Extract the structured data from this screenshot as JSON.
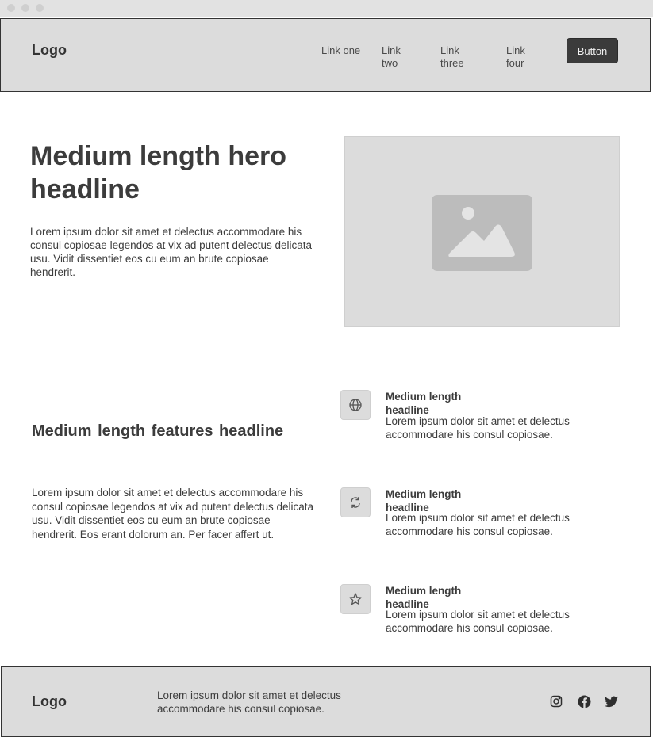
{
  "navbar": {
    "logo": "Logo",
    "links": [
      "Link one",
      "Link two",
      "Link three",
      "Link four"
    ],
    "button": "Button"
  },
  "hero": {
    "headline": "Medium length hero headline",
    "body": "Lorem ipsum dolor sit amet et delectus accommodare his consul copiosae legendos at vix ad putent delectus delicata usu. Vidit dissentiet eos cu eum an brute copiosae hendrerit.",
    "image_icon": "image-placeholder-icon"
  },
  "features": {
    "headline": "Medium length features headline",
    "body": "Lorem ipsum dolor sit amet et delectus accommodare his consul copiosae legendos at vix ad putent delectus delicata usu. Vidit dissentiet eos cu eum an brute copiosae hendrerit. Eos erant dolorum an. Per facer affert ut.",
    "items": [
      {
        "icon": "globe-icon",
        "title": "Medium length headline",
        "body": "Lorem ipsum dolor sit amet et delectus accommodare his consul copiosae."
      },
      {
        "icon": "refresh-icon",
        "title": "Medium length headline",
        "body": "Lorem ipsum dolor sit amet et delectus accommodare his consul copiosae."
      },
      {
        "icon": "star-icon",
        "title": "Medium length headline",
        "body": "Lorem ipsum dolor sit amet et delectus accommodare his consul copiosae."
      }
    ]
  },
  "footer": {
    "logo": "Logo",
    "text": "Lorem ipsum dolor sit amet et delectus accommodare his consul copiosae.",
    "social_icons": [
      "instagram-icon",
      "facebook-icon",
      "twitter-icon"
    ]
  },
  "colors": {
    "panel": "#dcdcdc",
    "button": "#3b3b3b",
    "text": "#3c3c3c"
  }
}
